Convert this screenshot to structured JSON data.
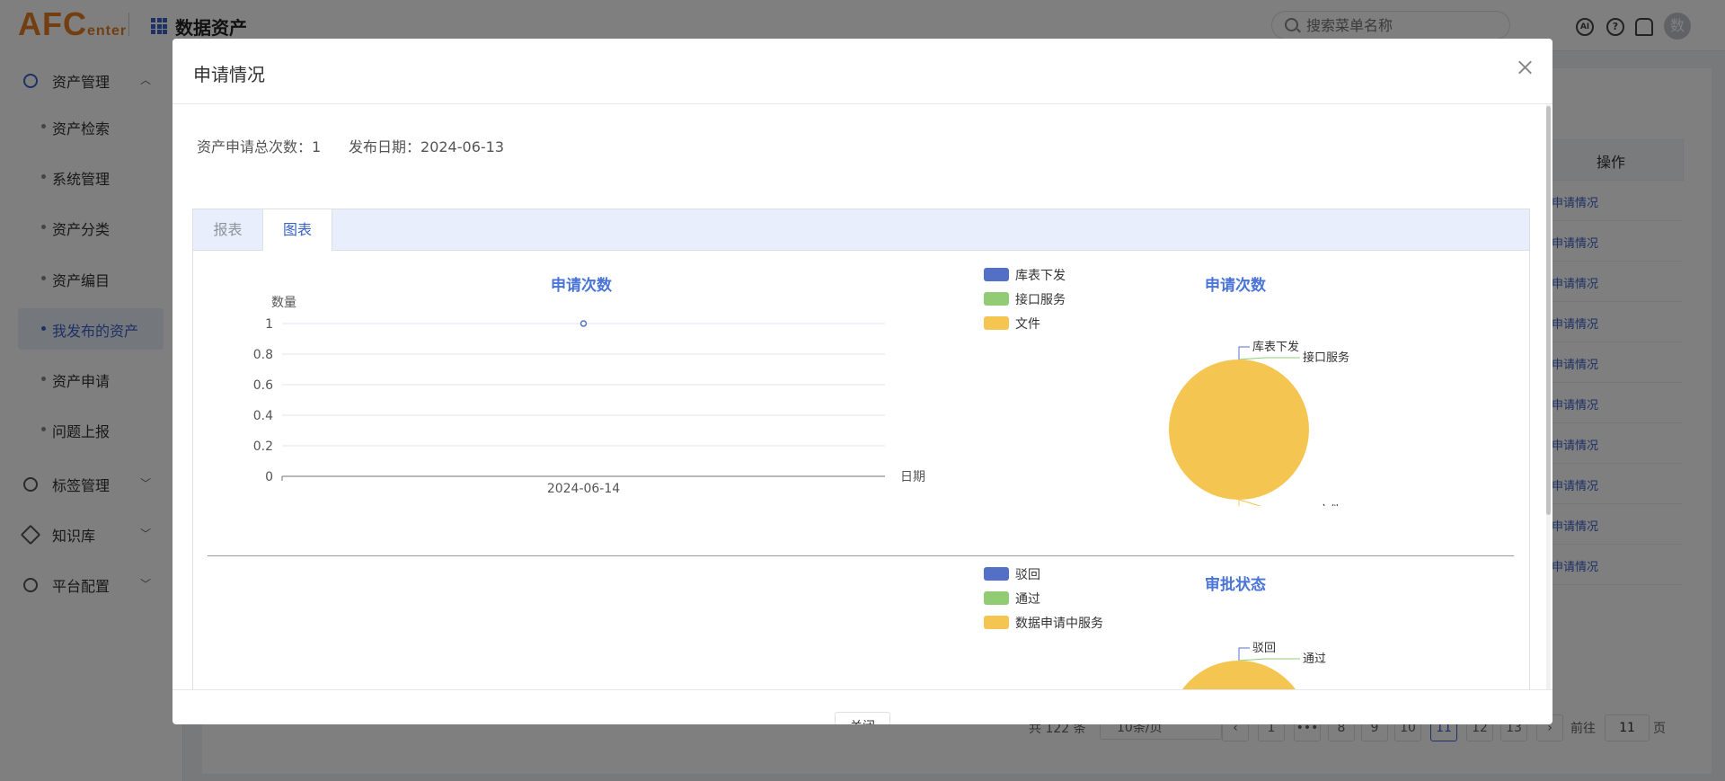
{
  "header": {
    "logo_main": "AFC",
    "logo_sub": "enter",
    "app_name": "数据资产",
    "search_placeholder": "搜索菜单名称",
    "avatar_text": "数",
    "ai_label": "AI",
    "help_label": "?"
  },
  "sidebar": {
    "groups": [
      {
        "label": "资产管理",
        "icon": "clock-icon",
        "expanded": true
      },
      {
        "label": "标签管理",
        "icon": "plus-circle-icon"
      },
      {
        "label": "知识库",
        "icon": "tag-icon"
      },
      {
        "label": "平台配置",
        "icon": "gear-icon"
      }
    ],
    "items": [
      {
        "label": "资产检索"
      },
      {
        "label": "系统管理"
      },
      {
        "label": "资产分类"
      },
      {
        "label": "资产编目"
      },
      {
        "label": "我发布的资产",
        "selected": true
      },
      {
        "label": "资产申请"
      },
      {
        "label": "问题上报"
      }
    ]
  },
  "background": {
    "table_header_op": "操作",
    "row_link": "申请情况",
    "pagination": {
      "total": "共 122 条",
      "page_size": "10条/页",
      "pages": [
        "1",
        "•••",
        "8",
        "9",
        "10",
        "11",
        "12",
        "13"
      ],
      "current": "11",
      "goto_label": "前往",
      "goto_value": "11",
      "page_suffix": "页"
    }
  },
  "dialog": {
    "title": "申请情况",
    "total_label": "资产申请总次数：",
    "total_value": "1",
    "date_label": "发布日期：",
    "date_value": "2024-06-13",
    "tabs": [
      "报表",
      "图表"
    ],
    "active_tab": "图表",
    "close_button": "关闭"
  },
  "chart_data": [
    {
      "type": "line",
      "title": "申请次数",
      "ylabel": "数量",
      "xlabel": "日期",
      "x": [
        "2024-06-14"
      ],
      "y": [
        1
      ],
      "y_ticks": [
        "0",
        "0.2",
        "0.4",
        "0.6",
        "0.8",
        "1"
      ],
      "ylim": [
        0,
        1
      ],
      "color": "#5470c6",
      "grid": true
    },
    {
      "type": "pie",
      "title": "申请次数",
      "legend_position": "left",
      "slices": [
        {
          "name": "库表下发",
          "value": 0,
          "color": "#5470c6"
        },
        {
          "name": "接口服务",
          "value": 0,
          "color": "#91cc75"
        },
        {
          "name": "文件",
          "value": 1,
          "color": "#f5c551"
        }
      ]
    },
    {
      "type": "pie",
      "title": "审批状态",
      "legend_position": "left",
      "legend": [
        "驳回",
        "通过",
        "数据申请中服务"
      ],
      "slices": [
        {
          "name": "驳回",
          "value": 0,
          "color": "#5470c6"
        },
        {
          "name": "通过",
          "value": 0,
          "color": "#91cc75"
        },
        {
          "name": "数据申请中服务",
          "value": 1,
          "color": "#f5c551"
        }
      ]
    }
  ]
}
